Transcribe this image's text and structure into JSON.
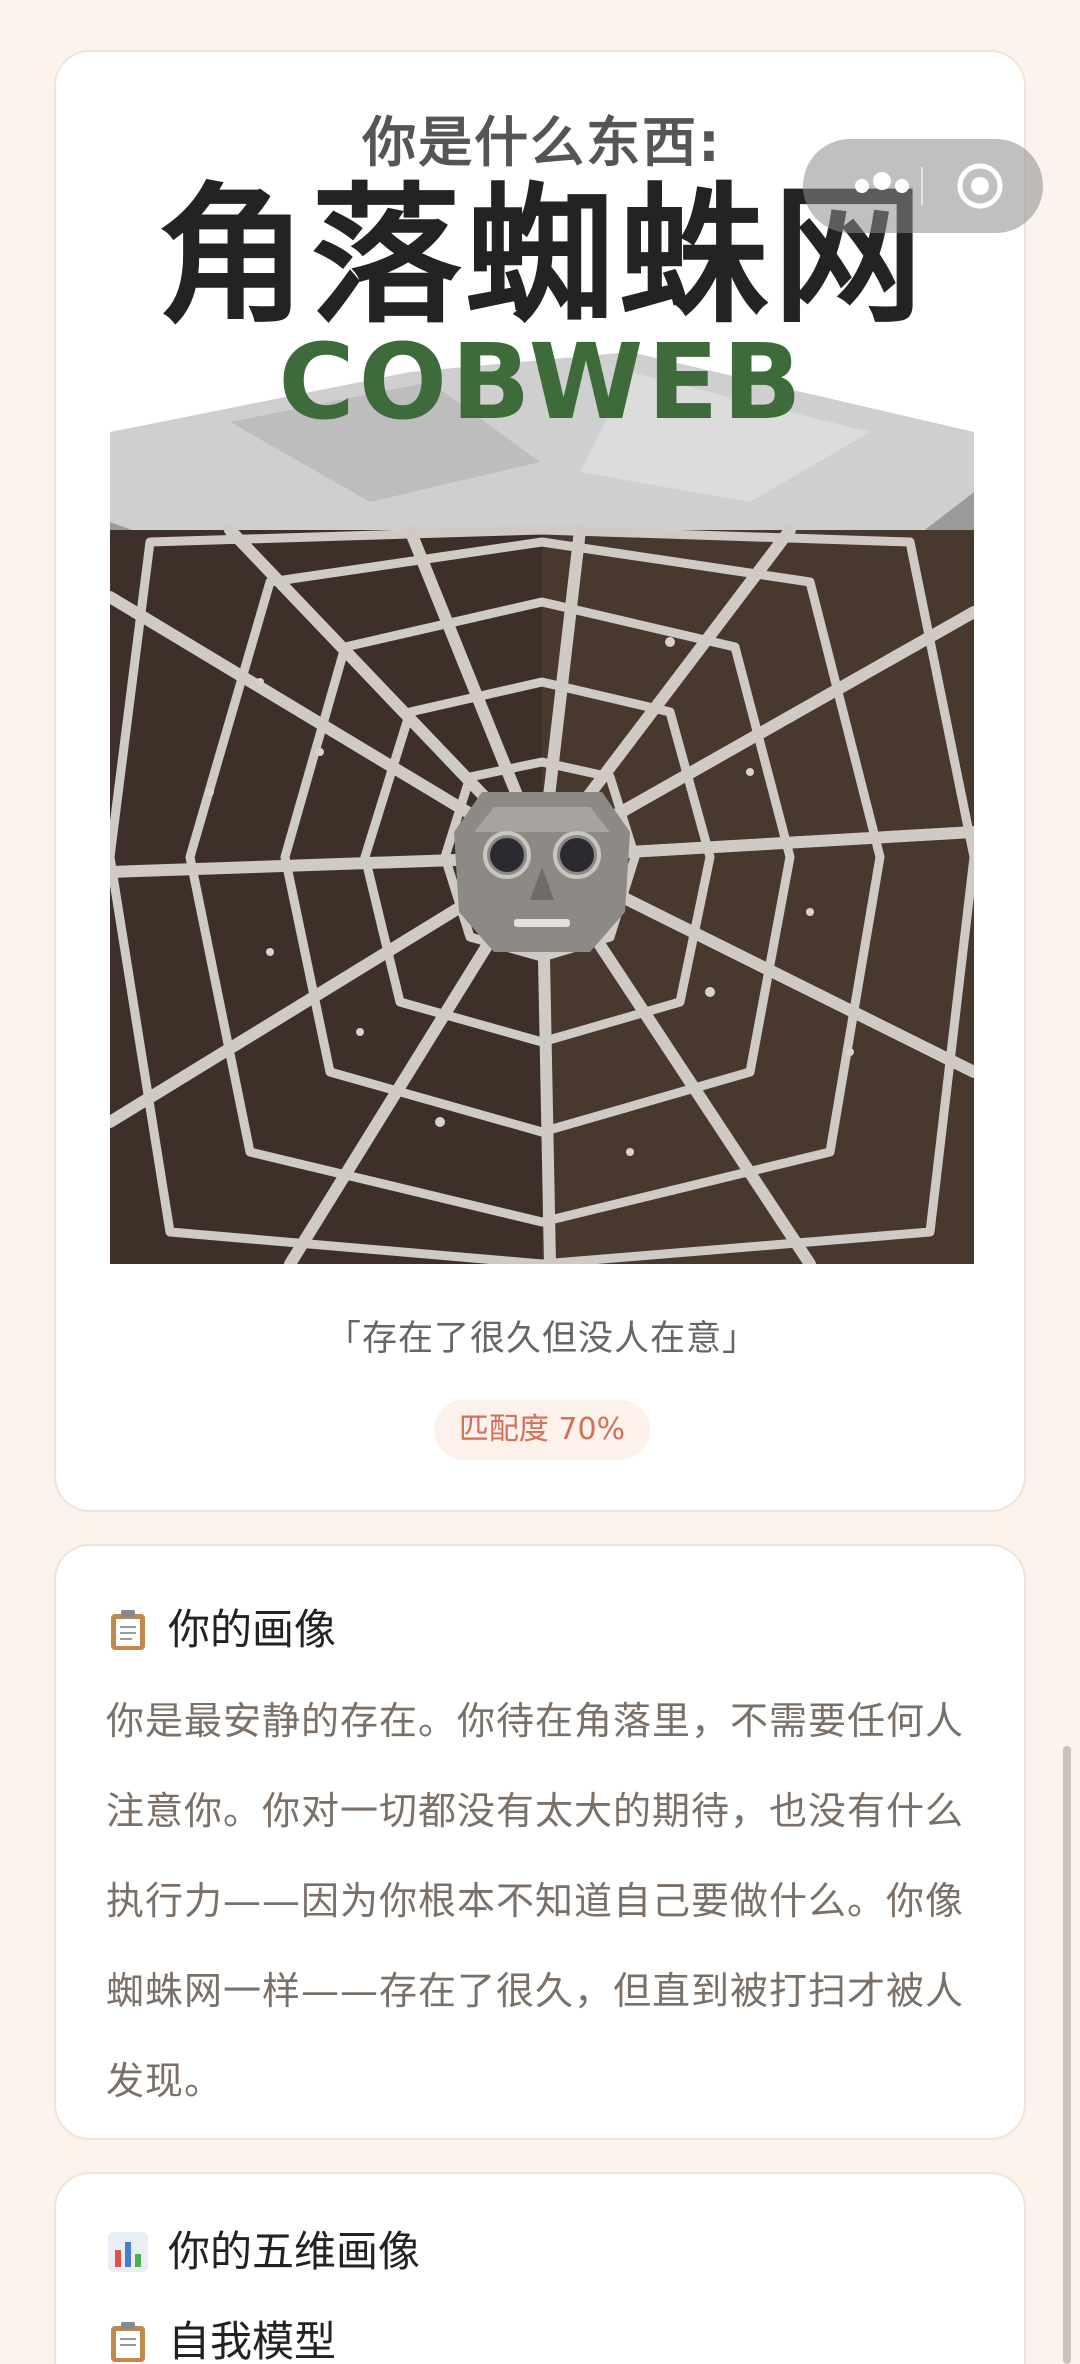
{
  "poster": {
    "kicker": "你是什么东西:",
    "title": "角落蜘蛛网",
    "subtitle": "COBWEB",
    "image": "cobweb-character-illustration"
  },
  "result": {
    "quote": "「存在了很久但没人在意」",
    "match": "匹配度 70%"
  },
  "capsule": {
    "more_icon": "more-dots-icon",
    "close_icon": "target-close-icon"
  },
  "portrait": {
    "icon": "clipboard-icon",
    "title": "你的画像",
    "body": "你是最安静的存在。你待在角落里，不需要任何人注意你。你对一切都没有太大的期待，也没有什么执行力——因为你根本不知道自己要做什么。你像蜘蛛网一样——存在了很久，但直到被打扫才被人发现。"
  },
  "dimensions": {
    "icon": "bar-chart-icon",
    "title": "你的五维画像",
    "first_dimension": {
      "icon": "clipboard-icon",
      "label": "自我模型"
    }
  },
  "colors": {
    "accent": "#d2705a",
    "brand_green": "#3d6b3a",
    "background": "#fbf3ec"
  }
}
